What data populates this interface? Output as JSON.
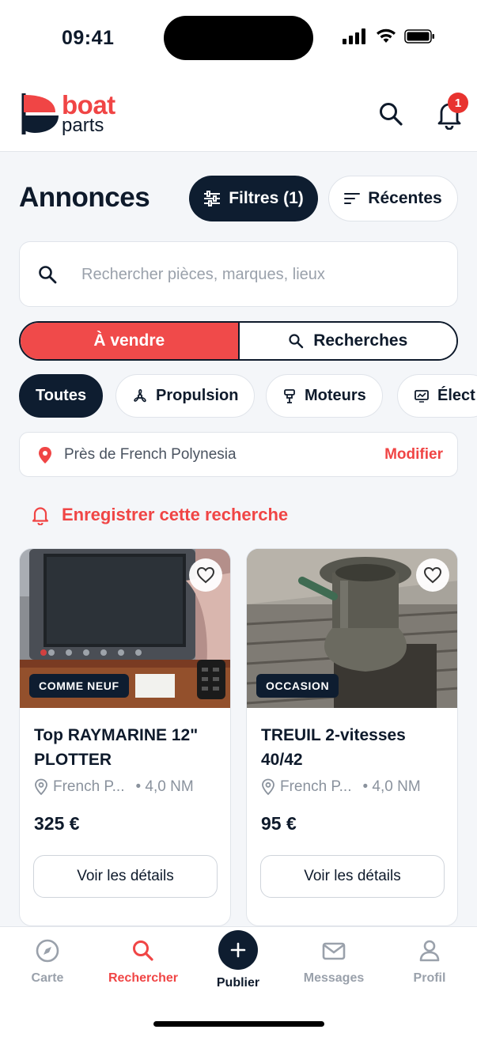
{
  "status_bar": {
    "time": "09:41"
  },
  "header": {
    "logo_word1": "boat",
    "logo_word2": "parts",
    "notification_count": "1"
  },
  "title": "Annonces",
  "filters_label": "Filtres (1)",
  "sort_label": "Récentes",
  "search": {
    "placeholder": "Rechercher pièces, marques, lieux"
  },
  "segment": {
    "sell": "À vendre",
    "wanted": "Recherches"
  },
  "categories": [
    {
      "label": "Toutes",
      "icon": "none",
      "active": true
    },
    {
      "label": "Propulsion",
      "icon": "propeller-icon",
      "active": false
    },
    {
      "label": "Moteurs",
      "icon": "engine-icon",
      "active": false
    },
    {
      "label": "Élect",
      "icon": "electronics-icon",
      "active": false
    }
  ],
  "location": {
    "text": "Près de French Polynesia",
    "modify": "Modifier"
  },
  "save_search_label": "Enregistrer cette recherche",
  "listings": [
    {
      "condition": "COMME NEUF",
      "title": "Top RAYMARINE 12\" PLOTTER",
      "location": "French P...",
      "distance": "• 4,0 NM",
      "price": "325 €",
      "button": "Voir les détails"
    },
    {
      "condition": "OCCASION",
      "title": "TREUIL 2-vitesses 40/42",
      "location": "French P...",
      "distance": "• 4,0 NM",
      "price": "95 €",
      "button": "Voir les détails"
    }
  ],
  "nav": {
    "map": "Carte",
    "search": "Rechercher",
    "publish": "Publier",
    "messages": "Messages",
    "profile": "Profil"
  },
  "colors": {
    "brand_red": "#f04545",
    "navy": "#0e1d30",
    "badge_red": "#e8332f"
  }
}
